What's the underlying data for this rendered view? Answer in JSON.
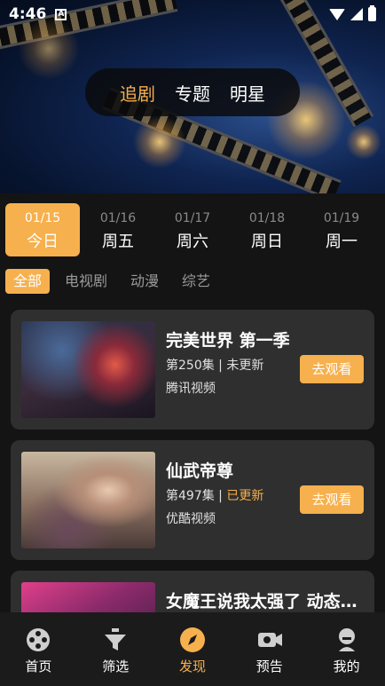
{
  "status": {
    "time": "4:46",
    "notif_letter": "A"
  },
  "top_tabs": [
    {
      "label": "追剧",
      "active": true
    },
    {
      "label": "专题",
      "active": false
    },
    {
      "label": "明星",
      "active": false
    }
  ],
  "dates": [
    {
      "date": "01/15",
      "weekday": "今日",
      "active": true
    },
    {
      "date": "01/16",
      "weekday": "周五",
      "active": false
    },
    {
      "date": "01/17",
      "weekday": "周六",
      "active": false
    },
    {
      "date": "01/18",
      "weekday": "周日",
      "active": false
    },
    {
      "date": "01/19",
      "weekday": "周一",
      "active": false
    }
  ],
  "categories": [
    {
      "label": "全部",
      "active": true
    },
    {
      "label": "电视剧",
      "active": false
    },
    {
      "label": "动漫",
      "active": false
    },
    {
      "label": "综艺",
      "active": false
    }
  ],
  "shows": [
    {
      "title": "完美世界 第一季",
      "episode": "第250集",
      "separator": " | ",
      "update": "未更新",
      "updated": false,
      "source": "腾讯视频",
      "button": "去观看"
    },
    {
      "title": "仙武帝尊",
      "episode": "第497集",
      "separator": " | ",
      "update": "已更新",
      "updated": true,
      "source": "优酷视频",
      "button": "去观看"
    },
    {
      "title": "女魔王说我太强了 动态漫画",
      "episode": "",
      "separator": "",
      "update": "",
      "updated": false,
      "source": "",
      "button": ""
    }
  ],
  "bottom_nav": [
    {
      "label": "首页",
      "icon": "film-reel-icon",
      "active": false
    },
    {
      "label": "筛选",
      "icon": "funnel-icon",
      "active": false
    },
    {
      "label": "发现",
      "icon": "compass-icon",
      "active": true
    },
    {
      "label": "预告",
      "icon": "video-camera-icon",
      "active": false
    },
    {
      "label": "我的",
      "icon": "user-profile-icon",
      "active": false
    }
  ],
  "colors": {
    "accent": "#f6b04d",
    "background": "#141414",
    "card": "#2f2f2f",
    "bottom_bar": "#1b1b1b"
  }
}
